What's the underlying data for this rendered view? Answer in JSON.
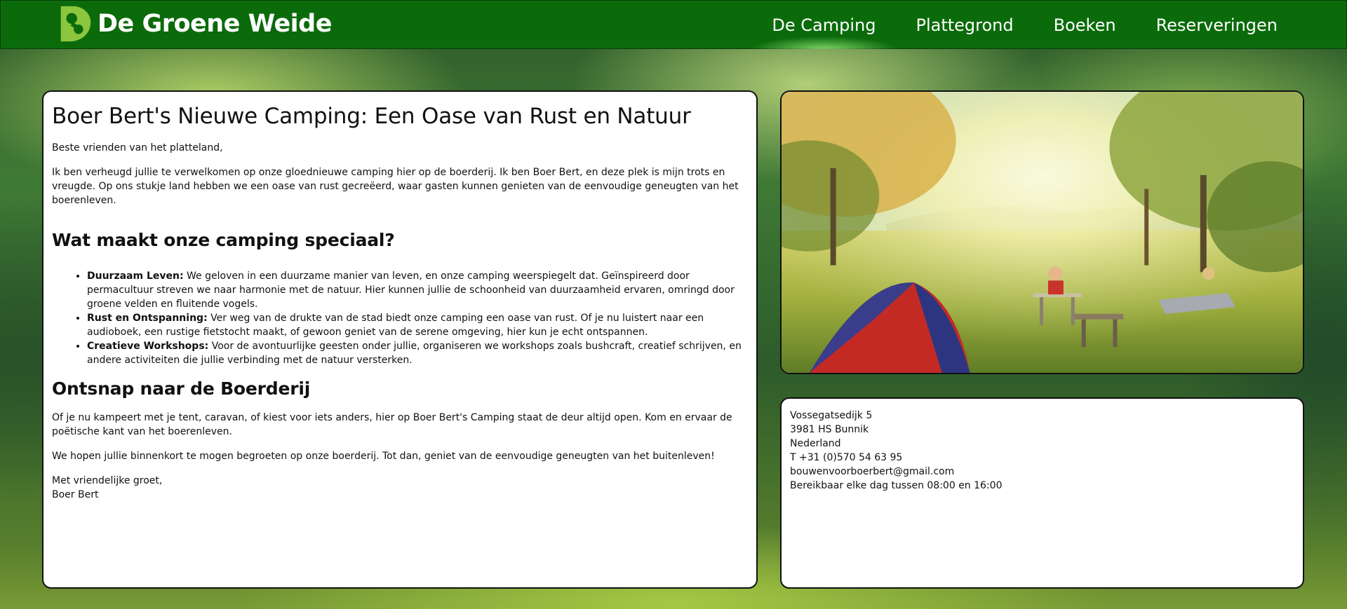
{
  "header": {
    "brand_title": "De Groene Weide",
    "nav": [
      {
        "label": "De Camping",
        "active": true
      },
      {
        "label": "Plattegrond",
        "active": false
      },
      {
        "label": "Boeken",
        "active": false
      },
      {
        "label": "Reserveringen",
        "active": false
      }
    ]
  },
  "main": {
    "title": "Boer Bert's Nieuwe Camping: Een Oase van Rust en Natuur",
    "greeting": "Beste vrienden van het platteland,",
    "intro": "Ik ben verheugd jullie te verwelkomen op onze gloednieuwe camping hier op de boerderij. Ik ben Boer Bert, en deze plek is mijn trots en vreugde. Op ons stukje land hebben we een oase van rust gecreëerd, waar gasten kunnen genieten van de eenvoudige geneugten van het boerenleven.",
    "special_heading": "Wat maakt onze camping speciaal?",
    "features": [
      {
        "title": "Duurzaam Leven:",
        "text": " We geloven in een duurzame manier van leven, en onze camping weerspiegelt dat. Geïnspireerd door permacultuur streven we naar harmonie met de natuur. Hier kunnen jullie de schoonheid van duurzaamheid ervaren, omringd door groene velden en fluitende vogels."
      },
      {
        "title": "Rust en Ontspanning:",
        "text": " Ver weg van de drukte van de stad biedt onze camping een oase van rust. Of je nu luistert naar een audioboek, een rustige fietstocht maakt, of gewoon geniet van de serene omgeving, hier kun je echt ontspannen."
      },
      {
        "title": "Creatieve Workshops:",
        "text": " Voor de avontuurlijke geesten onder jullie, organiseren we workshops zoals bushcraft, creatief schrijven, en andere activiteiten die jullie verbinding met de natuur versterken."
      }
    ],
    "escape_heading": "Ontsnap naar de Boerderij",
    "escape_text": "Of je nu kampeert met je tent, caravan, of kiest voor iets anders, hier op Boer Bert's Camping staat de deur altijd open. Kom en ervaar de poëtische kant van het boerenleven.",
    "hope_text": "We hopen jullie binnenkort te mogen begroeten op onze boerderij. Tot dan, geniet van de eenvoudige geneugten van het buitenleven!",
    "closing": "Met vriendelijke groet,",
    "signature": "Boer Bert"
  },
  "contact": {
    "street": "Vossegatsedijk 5",
    "postal_city": "3981 HS Bunnik",
    "country": "Nederland",
    "phone": "T +31 (0)570 54 63 95",
    "email": "bouwenvoorboerbert@gmail.com",
    "hours": "Bereikbaar elke dag tussen 08:00 en 16:00"
  },
  "colors": {
    "nav_background": "#0b6b0b",
    "logo": "#8cc63f",
    "panel_background": "#ffffff"
  },
  "icons": {
    "logo": "location-pin-logo-icon",
    "photo": "campsite-photo"
  }
}
